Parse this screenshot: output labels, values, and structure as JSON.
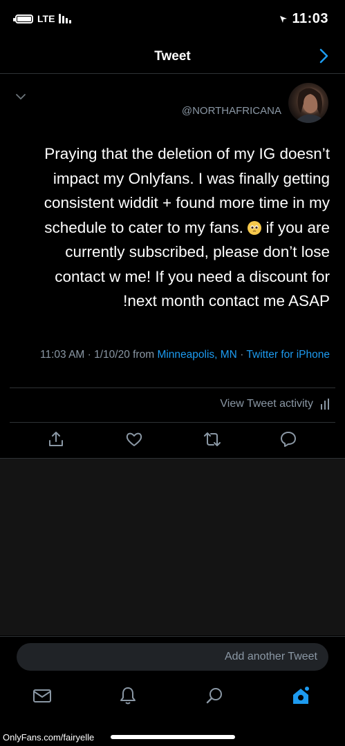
{
  "status_bar": {
    "time": "11:03",
    "network": "LTE"
  },
  "header": {
    "title": "Tweet"
  },
  "tweet": {
    "handle": "@NORTHAFRICANA",
    "text_lines": [
      "Praying that the deletion of my IG doesn’t",
      "impact my Onlyfans. I was finally getting",
      "consistent widdit + found more time in my",
      "schedule to cater to my fans.",
      "if you are",
      "currently subscribed, please don’t lose",
      "contact w me! If you need a discount for",
      "next month contact me ASAP!"
    ],
    "timestamp": "11:03 AM · 1/10/20 from",
    "location": "Minneapolis, MN",
    "separator": " · ",
    "source": "Twitter for iPhone",
    "view_activity": "View Tweet activity"
  },
  "compose": {
    "placeholder": "Add another Tweet"
  },
  "watermark": "OnlyFans.com/fairyelle",
  "colors": {
    "accent": "#1d9bf0",
    "muted": "#8b98a5",
    "background": "#000000"
  }
}
